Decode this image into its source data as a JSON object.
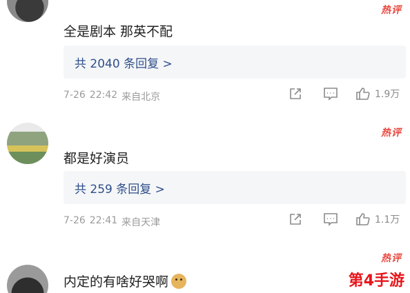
{
  "hot_label": "热评",
  "comments": [
    {
      "text": "全是剧本  那英不配",
      "replies": "共 2040 条回复 >",
      "date": "7-26",
      "time": "22:42",
      "location": "来自北京",
      "likes": "1.9万"
    },
    {
      "text": "都是好演员",
      "replies": "共 259 条回复 >",
      "date": "7-26",
      "time": "22:41",
      "location": "来自天津",
      "likes": "1.1万"
    },
    {
      "text": "内定的有啥好哭啊",
      "emoji": "doge"
    }
  ],
  "watermark": "第4手游",
  "colors": {
    "hot": "#e8463c",
    "link": "#2f4f8a",
    "meta": "#9a9a9a",
    "watermark": "#e8151b"
  }
}
